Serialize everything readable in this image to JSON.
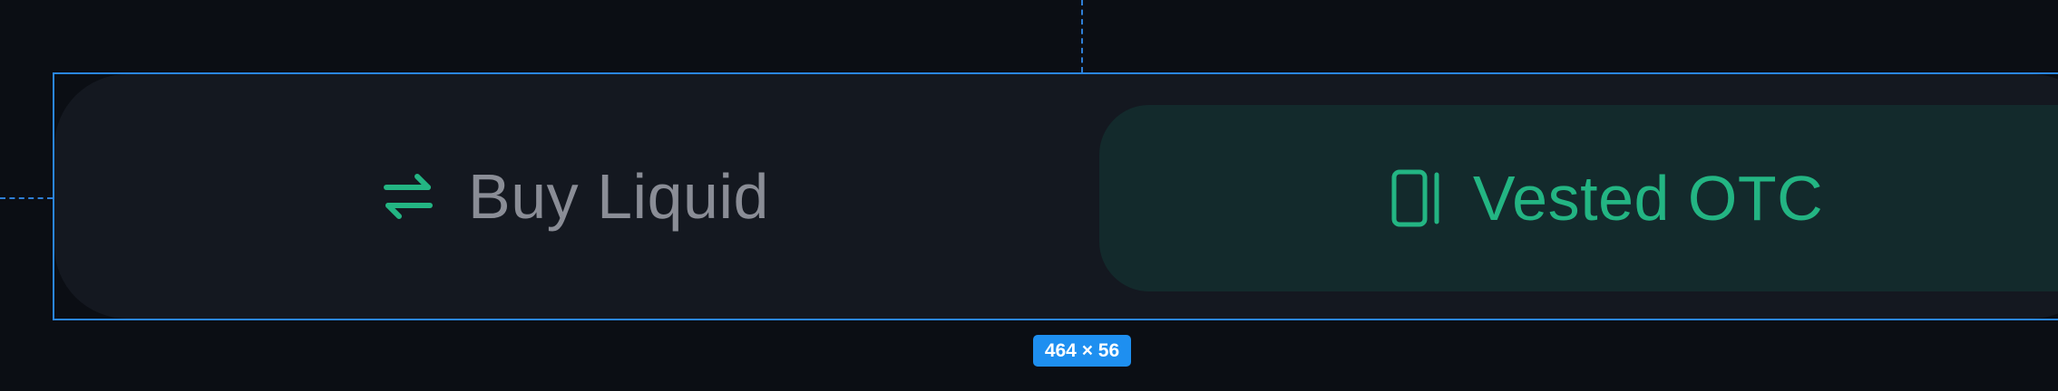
{
  "inspector": {
    "size_label": "464 × 56"
  },
  "tabs": [
    {
      "label": "Buy Liquid",
      "icon": "swap-arrows-icon",
      "active": false
    },
    {
      "label": "Vested OTC",
      "icon": "lock-panel-icon",
      "active": true
    }
  ],
  "colors": {
    "background": "#0b0e14",
    "switcher_bg": "#141820",
    "active_tab_bg": "#132a2c",
    "accent_green": "#23b583",
    "inactive_text": "#8a8d96",
    "inspector_blue": "#2a86e6"
  }
}
